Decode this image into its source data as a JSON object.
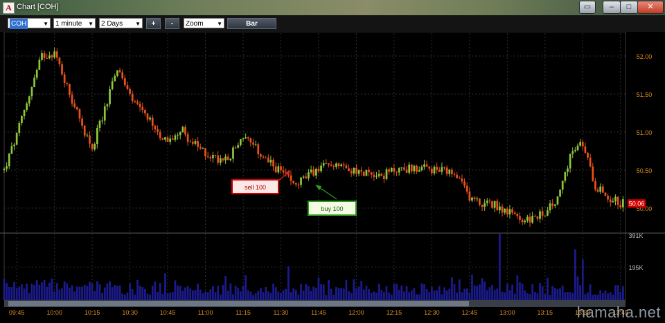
{
  "window": {
    "title": "Chart [COH]",
    "app_icon": "A"
  },
  "toolbar": {
    "symbol": "COH",
    "interval": "1 minute",
    "range": "2 Days",
    "zoom_in": "+",
    "zoom_out": "-",
    "zoom": "Zoom",
    "chart_style": "Bar"
  },
  "colors": {
    "up": "#8fc63b",
    "down": "#e8521c",
    "volume": "#1b1b8f",
    "axis": "#d98a1e",
    "last_price_bg": "#d40000"
  },
  "positions": [
    {
      "label": "sell 100",
      "price": 50.45
    },
    {
      "label": "buy 100",
      "price": 50.29
    }
  ],
  "watermark": "hamaha.net",
  "chart_data": {
    "type": "candlestick",
    "title": "Chart [COH]",
    "symbol": "COH",
    "interval": "1 minute",
    "grid": true,
    "x_ticks": [
      "09:45",
      "10:00",
      "10:15",
      "10:30",
      "10:45",
      "11:00",
      "11:15",
      "11:30",
      "11:45",
      "12:00",
      "12:15",
      "12:30",
      "12:45",
      "13:00",
      "13:15",
      "13:30",
      "13:45"
    ],
    "price_ticks": [
      "52.00",
      "51.50",
      "51.00",
      "50.50",
      "50.00"
    ],
    "ylim": [
      49.68,
      52.3
    ],
    "last_price": "50.06",
    "volume_ticks": [
      "391K",
      "195K"
    ],
    "volume_ylim": [
      0,
      391000
    ],
    "price_path_keypoints": [
      [
        "09:40",
        50.5
      ],
      [
        "09:45",
        50.95
      ],
      [
        "09:50",
        51.5
      ],
      [
        "09:55",
        52.0
      ],
      [
        "10:00",
        52.05
      ],
      [
        "10:05",
        51.6
      ],
      [
        "10:10",
        51.15
      ],
      [
        "10:15",
        50.8
      ],
      [
        "10:20",
        51.3
      ],
      [
        "10:25",
        51.85
      ],
      [
        "10:30",
        51.45
      ],
      [
        "10:35",
        51.25
      ],
      [
        "10:40",
        51.05
      ],
      [
        "10:45",
        50.85
      ],
      [
        "10:50",
        51.05
      ],
      [
        "10:55",
        50.85
      ],
      [
        "11:00",
        50.72
      ],
      [
        "11:05",
        50.65
      ],
      [
        "11:10",
        50.7
      ],
      [
        "11:15",
        50.95
      ],
      [
        "11:20",
        50.78
      ],
      [
        "11:25",
        50.6
      ],
      [
        "11:30",
        50.48
      ],
      [
        "11:35",
        50.3
      ],
      [
        "11:40",
        50.4
      ],
      [
        "11:45",
        50.52
      ],
      [
        "11:50",
        50.58
      ],
      [
        "11:55",
        50.6
      ],
      [
        "12:00",
        50.45
      ],
      [
        "12:05",
        50.48
      ],
      [
        "12:10",
        50.42
      ],
      [
        "12:15",
        50.5
      ],
      [
        "12:20",
        50.52
      ],
      [
        "12:25",
        50.53
      ],
      [
        "12:30",
        50.5
      ],
      [
        "12:35",
        50.48
      ],
      [
        "12:40",
        50.4
      ],
      [
        "12:45",
        50.15
      ],
      [
        "12:50",
        50.05
      ],
      [
        "12:55",
        50.05
      ],
      [
        "13:00",
        49.95
      ],
      [
        "13:05",
        49.85
      ],
      [
        "13:10",
        49.85
      ],
      [
        "13:15",
        49.95
      ],
      [
        "13:20",
        50.1
      ],
      [
        "13:25",
        50.7
      ],
      [
        "13:30",
        50.85
      ],
      [
        "13:35",
        50.3
      ],
      [
        "13:40",
        50.15
      ],
      [
        "13:45",
        50.06
      ]
    ]
  }
}
